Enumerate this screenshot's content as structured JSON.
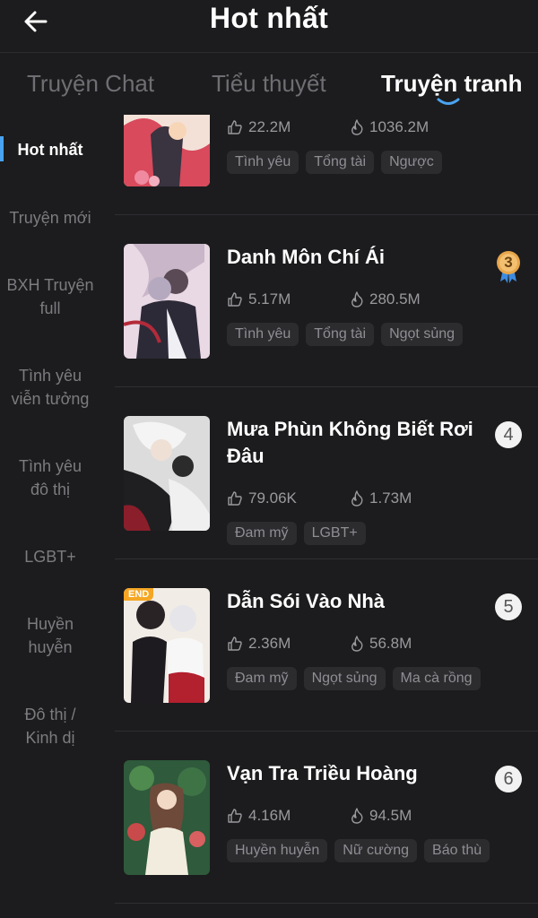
{
  "header": {
    "title": "Hot nhất",
    "back_icon": "arrow-left-icon"
  },
  "tabs": [
    {
      "label": "Truyện Chat",
      "active": false
    },
    {
      "label": "Tiểu thuyết",
      "active": false
    },
    {
      "label": "Truyện tranh",
      "active": true
    }
  ],
  "sidebar": {
    "items": [
      {
        "label": "Hot nhất",
        "active": true
      },
      {
        "label": "Truyện mới",
        "active": false
      },
      {
        "label": "BXH Truyện full",
        "active": false
      },
      {
        "label": "Tình yêu viễn tưởng",
        "active": false
      },
      {
        "label": "Tình yêu đô thị",
        "active": false
      },
      {
        "label": "LGBT+",
        "active": false
      },
      {
        "label": "Huyền huyễn",
        "active": false
      },
      {
        "label": "Đô thị / Kinh dị",
        "active": false
      }
    ]
  },
  "comics": [
    {
      "title": "",
      "likes": "22.2M",
      "views": "1036.2M",
      "tags": [
        "Tình yêu",
        "Tổng tài",
        "Ngược"
      ],
      "rank": "",
      "end": false
    },
    {
      "title": "Danh Môn Chí Ái",
      "likes": "5.17M",
      "views": "280.5M",
      "tags": [
        "Tình yêu",
        "Tổng tài",
        "Ngọt sủng"
      ],
      "rank": "3",
      "end": false
    },
    {
      "title": "Mưa Phùn Không Biết Rơi Đâu",
      "likes": "79.06K",
      "views": "1.73M",
      "tags": [
        "Đam mỹ",
        "LGBT+"
      ],
      "rank": "4",
      "end": false
    },
    {
      "title": "Dẫn Sói Vào Nhà",
      "likes": "2.36M",
      "views": "56.8M",
      "tags": [
        "Đam mỹ",
        "Ngọt sủng",
        "Ma cà rồng"
      ],
      "rank": "5",
      "end": true,
      "end_label": "END"
    },
    {
      "title": "Vạn Tra Triều Hoàng",
      "likes": "4.16M",
      "views": "94.5M",
      "tags": [
        "Huyền huyễn",
        "Nữ cường",
        "Báo thù"
      ],
      "rank": "6",
      "end": false
    }
  ],
  "colors": {
    "background": "#1c1c1e",
    "accent": "#4aa3f0",
    "medal": "#e8a64b"
  }
}
